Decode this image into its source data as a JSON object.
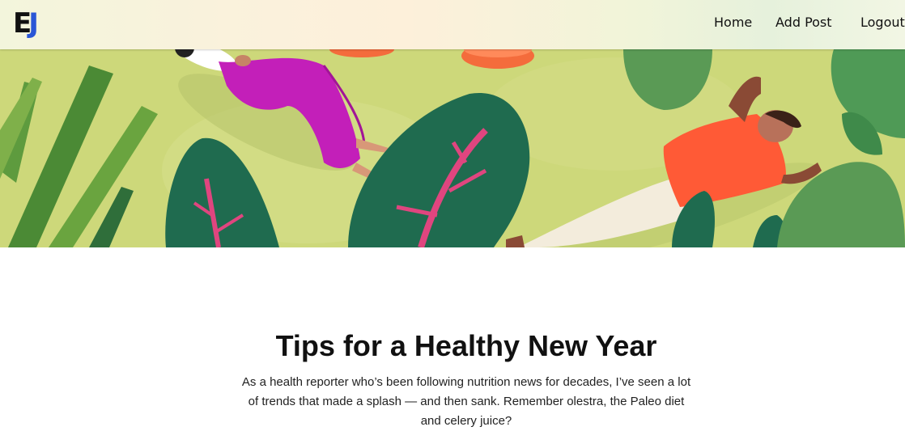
{
  "navbar": {
    "logo_e": "E",
    "logo_j": "J",
    "links": [
      {
        "label": "Home"
      },
      {
        "label": "Add Post"
      },
      {
        "label": "Logout"
      }
    ]
  },
  "hero": {
    "description": "illustration of people relaxing on grass among plants",
    "colors": {
      "grass": "#cfd97a",
      "leaf_dark": "#1f6b4f",
      "leaf_stem": "#e0457f",
      "pants": "#c31fb9",
      "shirt": "#ff5a36"
    }
  },
  "post": {
    "title": "Tips for a Healthy New Year",
    "body": "As a health reporter who’s been following nutrition news for decades, I’ve seen a lot of trends that made a splash — and then sank. Remember olestra, the Paleo diet and celery juice?"
  }
}
